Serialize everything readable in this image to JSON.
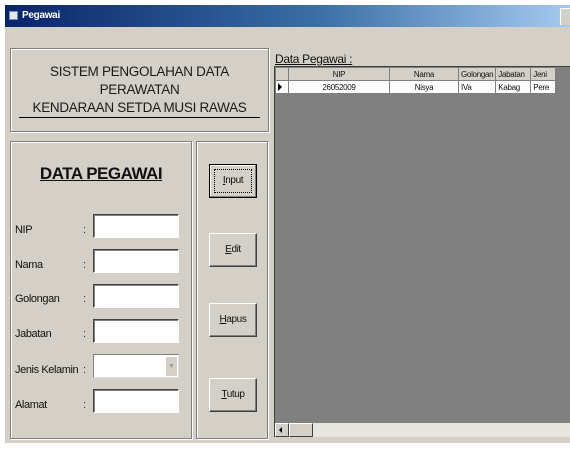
{
  "window": {
    "title": "Pegawai"
  },
  "header": {
    "line1": "SISTEM PENGOLAHAN DATA PERAWATAN",
    "line2": "KENDARAAN SETDA MUSI RAWAS"
  },
  "form": {
    "title": "DATA PEGAWAI",
    "colon": ":",
    "fields": [
      {
        "label": "NIP",
        "value": ""
      },
      {
        "label": "Nama",
        "value": ""
      },
      {
        "label": "Golongan",
        "value": ""
      },
      {
        "label": "Jabatan",
        "value": ""
      },
      {
        "label": "Jenis Kelamin",
        "value": ""
      },
      {
        "label": "Alamat",
        "value": ""
      }
    ]
  },
  "buttons": {
    "input": {
      "mnemonic": "I",
      "rest": "nput"
    },
    "edit": {
      "mnemonic": "E",
      "rest": "dit"
    },
    "hapus": {
      "mnemonic": "H",
      "rest": "apus"
    },
    "tutup": {
      "mnemonic": "T",
      "rest": "utup"
    }
  },
  "grid": {
    "caption": "Data Pegawai :",
    "columns": [
      "NIP",
      "Nama",
      "Golongan",
      "Jabatan",
      "Jeni"
    ],
    "rows": [
      [
        "26052009",
        "Nisya",
        "IVa",
        "Kabag",
        "Pere"
      ]
    ]
  }
}
